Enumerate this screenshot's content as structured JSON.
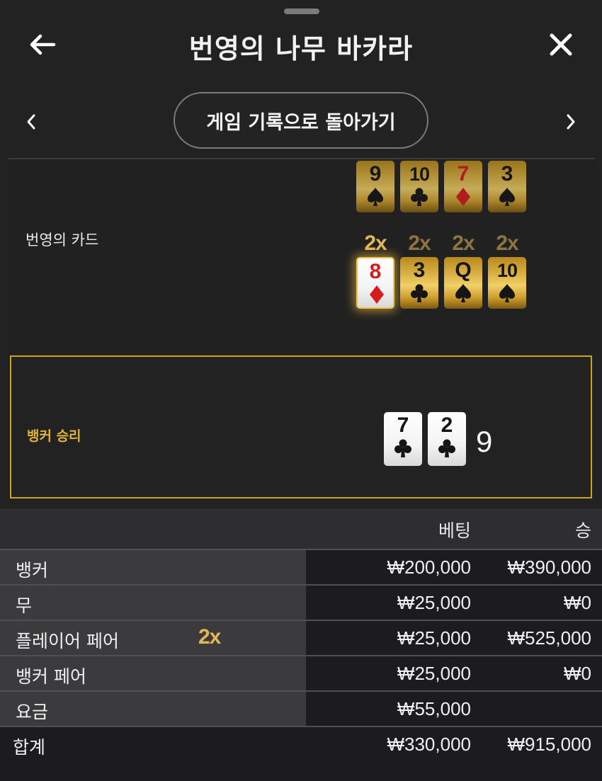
{
  "header": {
    "title": "번영의 나무 바카라"
  },
  "nav": {
    "history_label": "게임 기록으로 돌아가기"
  },
  "cards_section": {
    "label": "번영의 카드",
    "top_row": [
      {
        "rank": "9",
        "suit": "spade",
        "color": "black"
      },
      {
        "rank": "10",
        "suit": "club",
        "color": "black"
      },
      {
        "rank": "7",
        "suit": "diamond",
        "color": "red"
      },
      {
        "rank": "3",
        "suit": "spade",
        "color": "black"
      }
    ],
    "main_row": [
      {
        "rank": "8",
        "suit": "diamond",
        "color": "red",
        "multiplier": "2x",
        "highlighted": true
      },
      {
        "rank": "3",
        "suit": "club",
        "color": "black",
        "multiplier": "2x",
        "highlighted": false
      },
      {
        "rank": "Q",
        "suit": "spade",
        "color": "black",
        "multiplier": "2x",
        "highlighted": false
      },
      {
        "rank": "10",
        "suit": "spade",
        "color": "black",
        "multiplier": "2x",
        "highlighted": false
      }
    ]
  },
  "result": {
    "label": "뱅커 승리",
    "cards": [
      {
        "rank": "7",
        "suit": "club"
      },
      {
        "rank": "2",
        "suit": "club"
      }
    ],
    "total": "9"
  },
  "bets_table": {
    "headers": {
      "bet": "베팅",
      "win": "승"
    },
    "rows": [
      {
        "name": "뱅커",
        "badge": "",
        "bet": "₩200,000",
        "win": "₩390,000"
      },
      {
        "name": "무",
        "badge": "",
        "bet": "₩25,000",
        "win": "₩0"
      },
      {
        "name": "플레이어 페어",
        "badge": "2x",
        "bet": "₩25,000",
        "win": "₩525,000"
      },
      {
        "name": "뱅커 페어",
        "badge": "",
        "bet": "₩25,000",
        "win": "₩0"
      },
      {
        "name": "요금",
        "badge": "",
        "bet": "₩55,000",
        "win": ""
      }
    ],
    "total": {
      "name": "합계",
      "bet": "₩330,000",
      "win": "₩915,000"
    }
  },
  "colors": {
    "background": "#222222",
    "gold_accent": "#e4b655",
    "result_border": "#cba51f",
    "red_suit": "#d51b1b"
  }
}
